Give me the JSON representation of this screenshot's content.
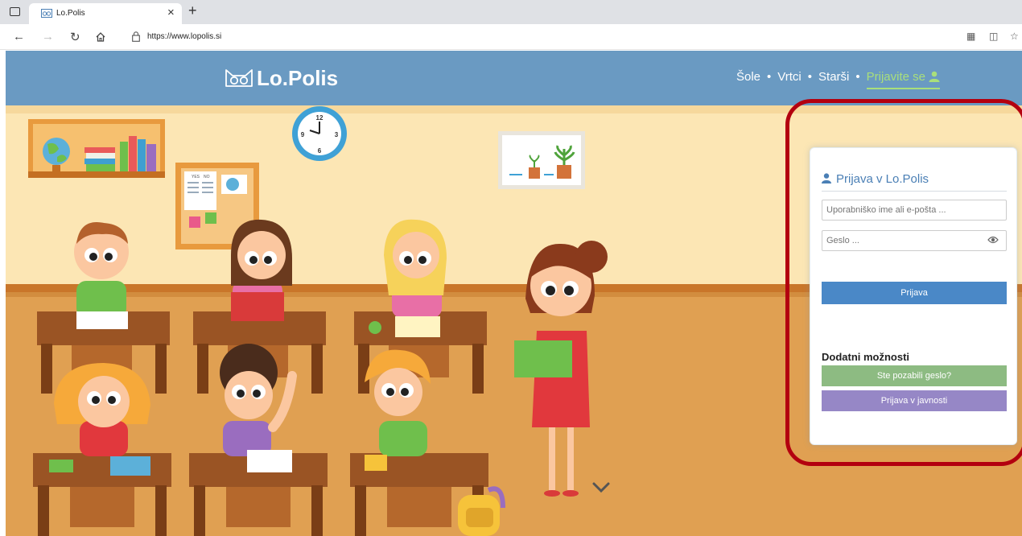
{
  "browser": {
    "tab_title": "Lo.Polis",
    "tab_close": "×",
    "new_tab": "+",
    "url": "https://www.lopolis.si",
    "icons": [
      "window-menu-icon",
      "back-arrow-icon",
      "forward-arrow-icon",
      "reload-icon",
      "home-icon",
      "lock-icon",
      "reader-icon",
      "collections-icon",
      "favorites-icon"
    ]
  },
  "header": {
    "brand": "Lo.Polis",
    "nav": {
      "schools": "Šole",
      "kindergartens": "Vrtci",
      "parents": "Starši",
      "login": "Prijavite se",
      "separator": "•"
    },
    "colors": {
      "bar": "#6a9ac2",
      "accent": "#a9df7b"
    }
  },
  "login_card": {
    "title": "Prijava v Lo.Polis",
    "username_placeholder": "Uporabniško ime ali e-pošta ...",
    "password_placeholder": "Geslo ...",
    "submit_label": "Prijava",
    "extra_title": "Dodatni možnosti",
    "forgot_label": "Ste pozabili geslo?",
    "public_label": "Prijava v javnosti",
    "colors": {
      "title": "#4a7fb5",
      "submit": "#4a88c7",
      "forgot": "#8dbb82",
      "public": "#9687c6",
      "highlight": "#b3000f"
    }
  },
  "illustration": {
    "clock": {
      "n12": "12",
      "n3": "3",
      "n6": "6",
      "n9": "9"
    },
    "board": {
      "yes": "YES",
      "no": "NO"
    },
    "scroll_icon": "chevron-down-icon"
  }
}
